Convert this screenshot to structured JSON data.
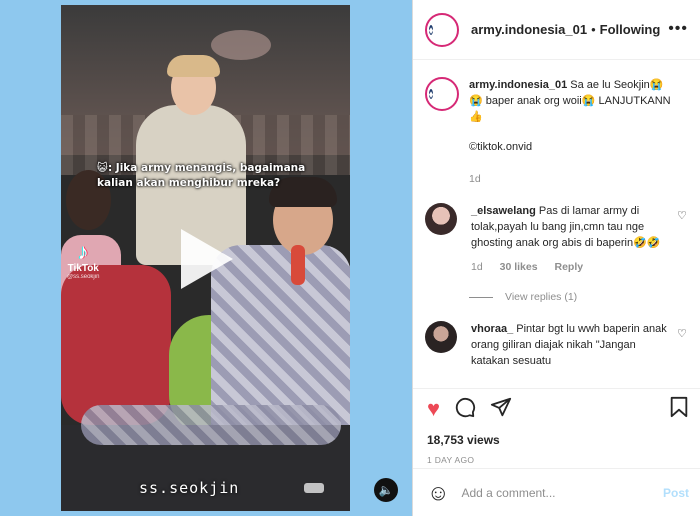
{
  "video": {
    "caption": "😺: Jika army menangis, bagaimana kalian akan menghibur mreka?",
    "tiktok_label": "TikTok",
    "tiktok_handle": "@ss.seokjin",
    "watermark": "ss.seokjin"
  },
  "header": {
    "username": "army.indonesia_01",
    "separator": "•",
    "follow_status": "Following",
    "more_icon": "ellipsis-icon"
  },
  "post": {
    "username": "army.indonesia_01",
    "caption": "Sa ae lu Seokjin😭😭 baper anak org woii😭 LANJUTKANN👍",
    "credit": "©tiktok.onvid",
    "age": "1d"
  },
  "comments": [
    {
      "username": "_elsawelang",
      "text": "Pas di lamar army di tolak,payah lu bang jin,cmn tau nge ghosting anak org abis di baperin🤣🤣",
      "age": "1d",
      "likes": "30 likes",
      "reply": "Reply",
      "view_replies": "View replies (1)"
    },
    {
      "username": "vhoraa_",
      "text": "Pintar bgt lu wwh baperin anak orang giliran diajak nikah \"Jangan katakan sesuatu"
    }
  ],
  "actions": {
    "views": "18,753 views",
    "time_ago": "1 DAY AGO"
  },
  "add_comment": {
    "placeholder": "Add a comment...",
    "post_label": "Post"
  },
  "colors": {
    "background": "#8ec8ee",
    "like": "#ed4956",
    "post_disabled": "#b2dffc",
    "muted": "#8e8e8e"
  }
}
